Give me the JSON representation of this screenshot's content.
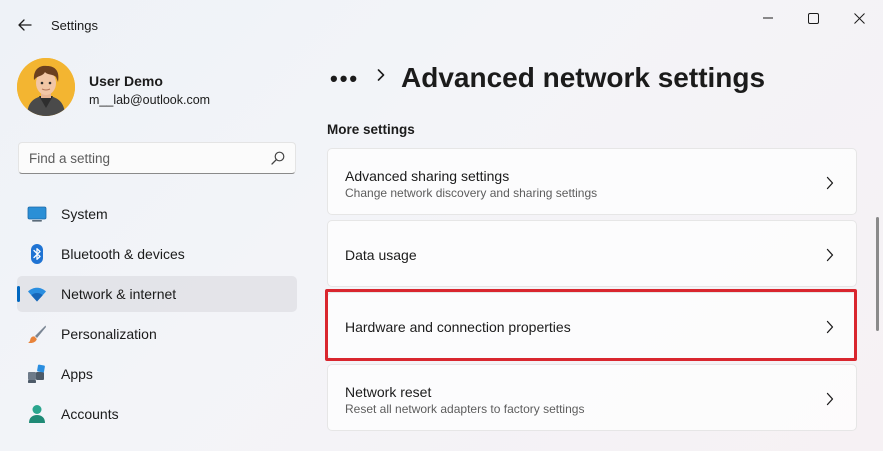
{
  "window": {
    "title": "Settings",
    "controls": [
      "minimize",
      "maximize",
      "close"
    ]
  },
  "profile": {
    "name": "User Demo",
    "email": "m__lab@outlook.com"
  },
  "search": {
    "placeholder": "Find a setting"
  },
  "sidebar": {
    "items": [
      {
        "label": "System",
        "icon": "monitor-icon",
        "selected": false
      },
      {
        "label": "Bluetooth & devices",
        "icon": "bluetooth-icon",
        "selected": false
      },
      {
        "label": "Network & internet",
        "icon": "wifi-icon",
        "selected": true
      },
      {
        "label": "Personalization",
        "icon": "brush-icon",
        "selected": false
      },
      {
        "label": "Apps",
        "icon": "apps-icon",
        "selected": false
      },
      {
        "label": "Accounts",
        "icon": "person-icon",
        "selected": false
      }
    ]
  },
  "header": {
    "breadcrumb_overflow": "•••",
    "title": "Advanced network settings"
  },
  "main": {
    "section_title": "More settings",
    "cards": [
      {
        "title": "Advanced sharing settings",
        "subtitle": "Change network discovery and sharing settings"
      },
      {
        "title": "Data usage",
        "subtitle": ""
      },
      {
        "title": "Hardware and connection properties",
        "subtitle": "",
        "highlighted": true
      },
      {
        "title": "Network reset",
        "subtitle": "Reset all network adapters to factory settings"
      }
    ]
  },
  "colors": {
    "accent": "#0067c0",
    "highlight": "#d9262e"
  }
}
